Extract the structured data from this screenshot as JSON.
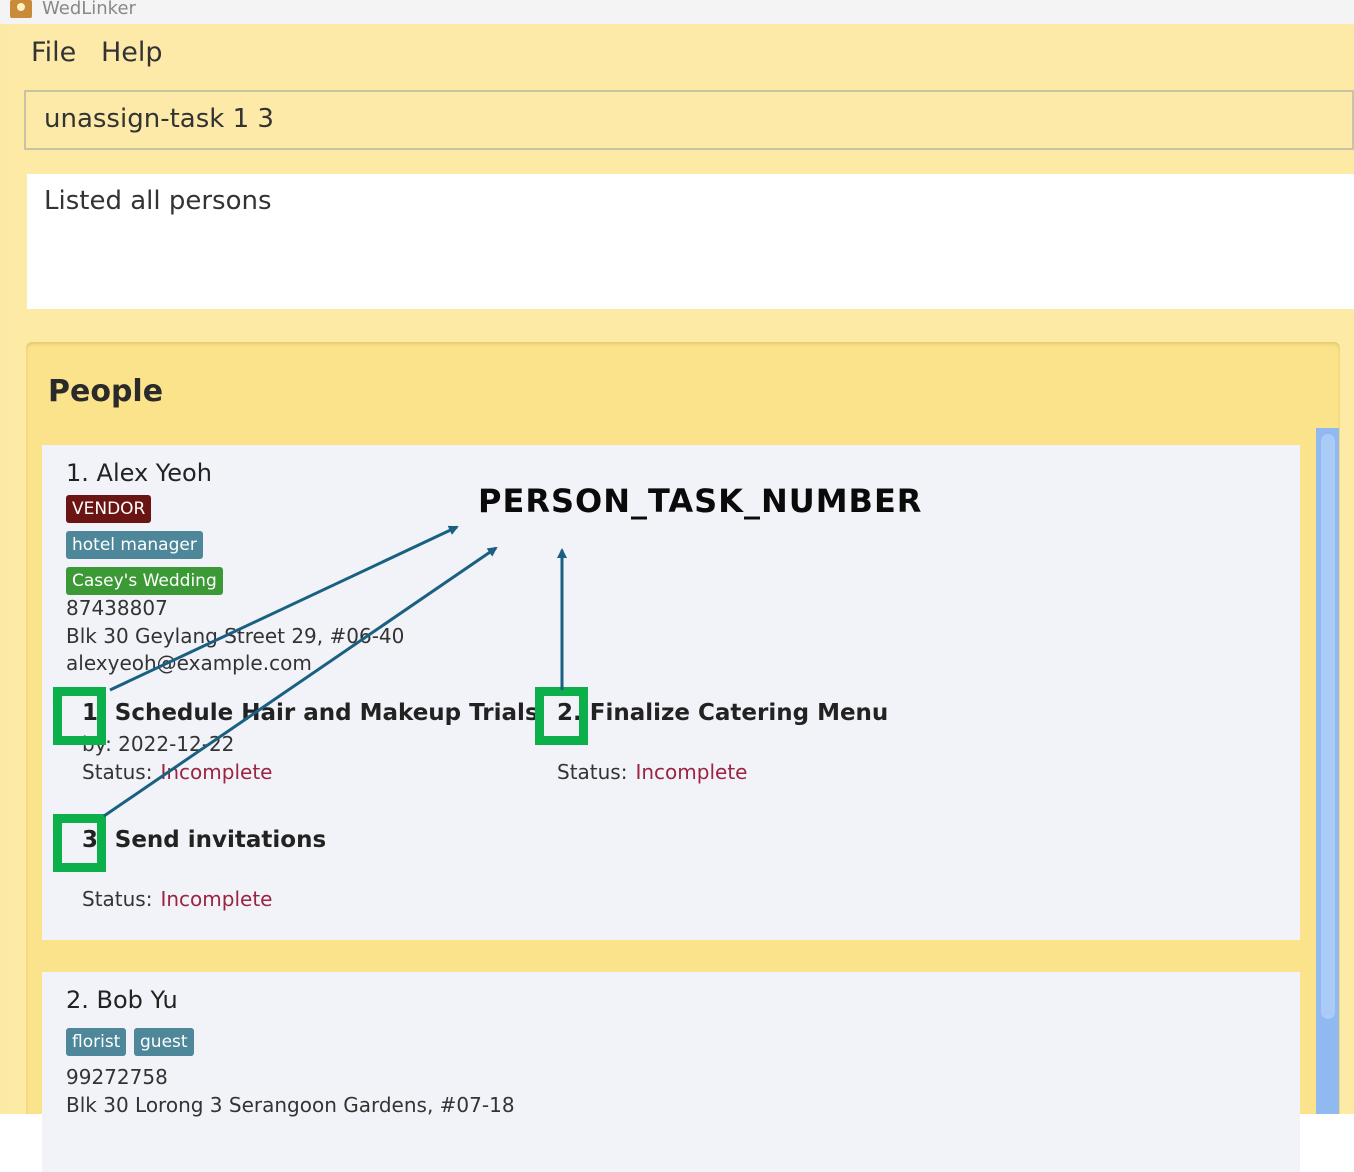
{
  "app": {
    "title": "WedLinker"
  },
  "menu": {
    "file": "File",
    "help": "Help"
  },
  "command": {
    "value": "unassign-task 1 3"
  },
  "result": {
    "text": "Listed all persons"
  },
  "people": {
    "title": "People",
    "persons": [
      {
        "name": "1. Alex Yeoh",
        "tags": [
          "VENDOR",
          "hotel manager",
          "Casey's Wedding"
        ],
        "phone": "87438807",
        "address": "Blk 30 Geylang Street 29, #06-40",
        "email": "alexyeoh@example.com",
        "tasks": [
          {
            "title": "1. Schedule Hair and Makeup Trials",
            "by": "by: 2022-12-22",
            "status_label": "Status:",
            "status": "Incomplete"
          },
          {
            "title": "2. Finalize Catering Menu",
            "status_label": "Status:",
            "status": "Incomplete"
          },
          {
            "title": "3. Send invitations",
            "status_label": "Status:",
            "status": "Incomplete"
          }
        ]
      },
      {
        "name": "2. Bob Yu",
        "tags": [
          "florist",
          "guest"
        ],
        "phone": "99272758",
        "address": "Blk 30 Lorong 3 Serangoon Gardens, #07-18"
      }
    ]
  },
  "annotation": {
    "label": "PERSON_TASK_NUMBER"
  },
  "colors": {
    "vendor_tag": "#6b1414",
    "role_tag": "#4d8799",
    "wedding_tag": "#3c9a36",
    "highlight_box": "#0cb04a",
    "arrow": "#1a6080",
    "status_incomplete": "#9b2440"
  }
}
